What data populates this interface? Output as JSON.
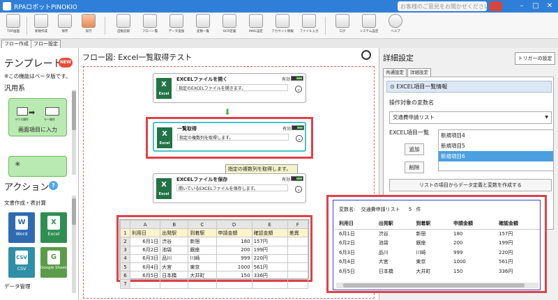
{
  "window": {
    "title": "RPAロボットPINOKIO",
    "feedback": "お客様のご意見をお聞かせください"
  },
  "toolbar": {
    "items": [
      "TOP画面",
      "新規作成",
      "保存",
      "実行",
      "自動記録",
      "フロー一覧",
      "データ変換",
      "変数一覧",
      "OCR定義",
      "MAIL設定",
      "アカウント情報",
      "ファイル入力",
      "ログ",
      "システム設定",
      "ヘルプ"
    ]
  },
  "panel_tabs": [
    "フロー作成",
    "フロー設定"
  ],
  "left": {
    "template_title": "テンプレート",
    "new_badge": "NEW",
    "beta_note": "※この機能はベータ版です。",
    "category": "汎用系",
    "card_label": "画面項目に入力",
    "card_caption_left": "マウス操作",
    "card_caption_right": "キー操作",
    "action_title": "アクション",
    "help": "?",
    "subcat1": "文書作成・表計算",
    "apps": [
      {
        "label": "Word",
        "glyph": "W"
      },
      {
        "label": "Excel",
        "glyph": "X"
      },
      {
        "label": "CSV",
        "glyph": "CSV"
      },
      {
        "label": "Google Sheets",
        "glyph": "G"
      }
    ],
    "subcat2": "データ管理"
  },
  "flow": {
    "title": "フロー図:  Excel一覧取得テスト",
    "nodes": [
      {
        "title": "EXCELファイルを開く",
        "desc": "指定のEXCELファイルを開きます。",
        "enabled": "有効",
        "chevron": "⌄"
      },
      {
        "title": "一覧取得",
        "desc": "指定の複数列を取得します。",
        "enabled": "有効",
        "chevron": "⌄"
      },
      {
        "title": "EXCELファイルを保存",
        "desc": "開いているEXCELファイルを保存します。",
        "enabled": "有効",
        "chevron": "⌄"
      }
    ],
    "excel_glyph": "X",
    "excel_label": "Excel",
    "tooltip": "指定の複数列を取得します。"
  },
  "sheet": {
    "cols": [
      "",
      "A",
      "B",
      "C",
      "D",
      "E",
      "F"
    ],
    "rows": [
      [
        "1",
        "利用日",
        "出発駅",
        "到着駅",
        "申請金額",
        "確認金額",
        "差異"
      ],
      [
        "2",
        "6月1日",
        "渋谷",
        "新宿",
        "180",
        "157円",
        ""
      ],
      [
        "3",
        "6月2日",
        "池袋",
        "銀座",
        "200",
        "199円",
        ""
      ],
      [
        "4",
        "6月3日",
        "品川",
        "川崎",
        "999",
        "220円",
        ""
      ],
      [
        "5",
        "6月4日",
        "大宮",
        "東京",
        "1000",
        "561円",
        ""
      ],
      [
        "6",
        "6月5日",
        "日本橋",
        "大井町",
        "150",
        "336円",
        ""
      ],
      [
        "7",
        "",
        "",
        "",
        "",
        "",
        ""
      ]
    ]
  },
  "detail": {
    "title": "詳細設定",
    "trigger": "トリガーの設定",
    "tabs": [
      "共通設定",
      "詳細設定"
    ],
    "section": "EXCEL項目一覧情報",
    "var_label": "操作対象の変数名",
    "var_value": "交通費申請リスト",
    "list_label": "EXCEL項目一覧",
    "add": "追加",
    "remove": "削除",
    "list_items": [
      "新規項目4",
      "新規項目5",
      "新規項目6"
    ],
    "make_btn": "リストの項目からデータ定義と変数を作成する"
  },
  "preview": {
    "var_label": "変数名:",
    "var_name": "交通費申請リスト",
    "count": "5",
    "count_unit": "件",
    "headers": [
      "利用日",
      "出発駅",
      "到着駅",
      "申請金額",
      "確認金額"
    ],
    "rows": [
      [
        "6月1日",
        "渋谷",
        "新宿",
        "180",
        "157円"
      ],
      [
        "6月2日",
        "池袋",
        "銀座",
        "200",
        "199円"
      ],
      [
        "6月3日",
        "品川",
        "川崎",
        "999",
        "220円"
      ],
      [
        "6月4日",
        "大宮",
        "東京",
        "1000",
        "561円"
      ],
      [
        "6月5日",
        "日本橋",
        "大井町",
        "150",
        "336円"
      ]
    ]
  },
  "colors": {
    "titlebar": "#2f7fd8",
    "highlight": "#e04048",
    "excel": "#217346",
    "template_card": "#b9eab2"
  }
}
